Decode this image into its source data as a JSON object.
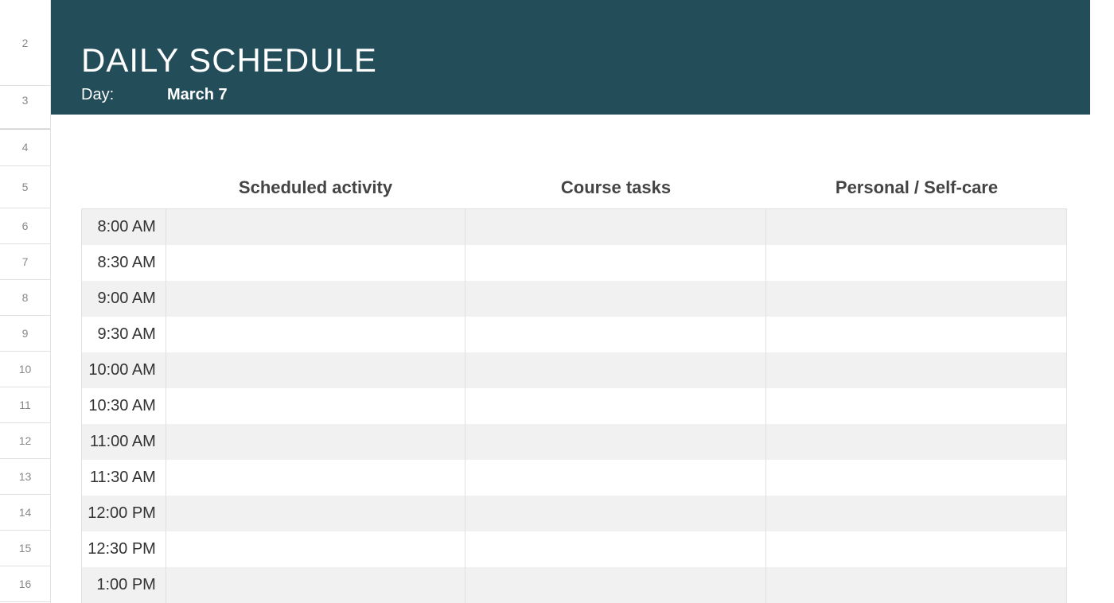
{
  "row_headers": {
    "r2": "2",
    "r3": "3",
    "r4": "4",
    "r5": "5",
    "r6": "6",
    "r7": "7",
    "r8": "8",
    "r9": "9",
    "r10": "10",
    "r11": "11",
    "r12": "12",
    "r13": "13",
    "r14": "14",
    "r15": "15",
    "r16": "16"
  },
  "header": {
    "title": "DAILY SCHEDULE",
    "day_label": "Day:",
    "day_value": "March 7"
  },
  "columns": {
    "activity": "Scheduled activity",
    "tasks": "Course tasks",
    "personal": "Personal / Self-care"
  },
  "rows": [
    {
      "time": "8:00 AM",
      "activity": "",
      "tasks": "",
      "personal": "",
      "alt": true
    },
    {
      "time": "8:30 AM",
      "activity": "",
      "tasks": "",
      "personal": "",
      "alt": false
    },
    {
      "time": "9:00 AM",
      "activity": "",
      "tasks": "",
      "personal": "",
      "alt": true
    },
    {
      "time": "9:30 AM",
      "activity": "",
      "tasks": "",
      "personal": "",
      "alt": false
    },
    {
      "time": "10:00 AM",
      "activity": "",
      "tasks": "",
      "personal": "",
      "alt": true
    },
    {
      "time": "10:30 AM",
      "activity": "",
      "tasks": "",
      "personal": "",
      "alt": false
    },
    {
      "time": "11:00 AM",
      "activity": "",
      "tasks": "",
      "personal": "",
      "alt": true
    },
    {
      "time": "11:30 AM",
      "activity": "",
      "tasks": "",
      "personal": "",
      "alt": false
    },
    {
      "time": "12:00 PM",
      "activity": "",
      "tasks": "",
      "personal": "",
      "alt": true
    },
    {
      "time": "12:30 PM",
      "activity": "",
      "tasks": "",
      "personal": "",
      "alt": false
    },
    {
      "time": "1:00 PM",
      "activity": "",
      "tasks": "",
      "personal": "",
      "alt": true
    }
  ]
}
